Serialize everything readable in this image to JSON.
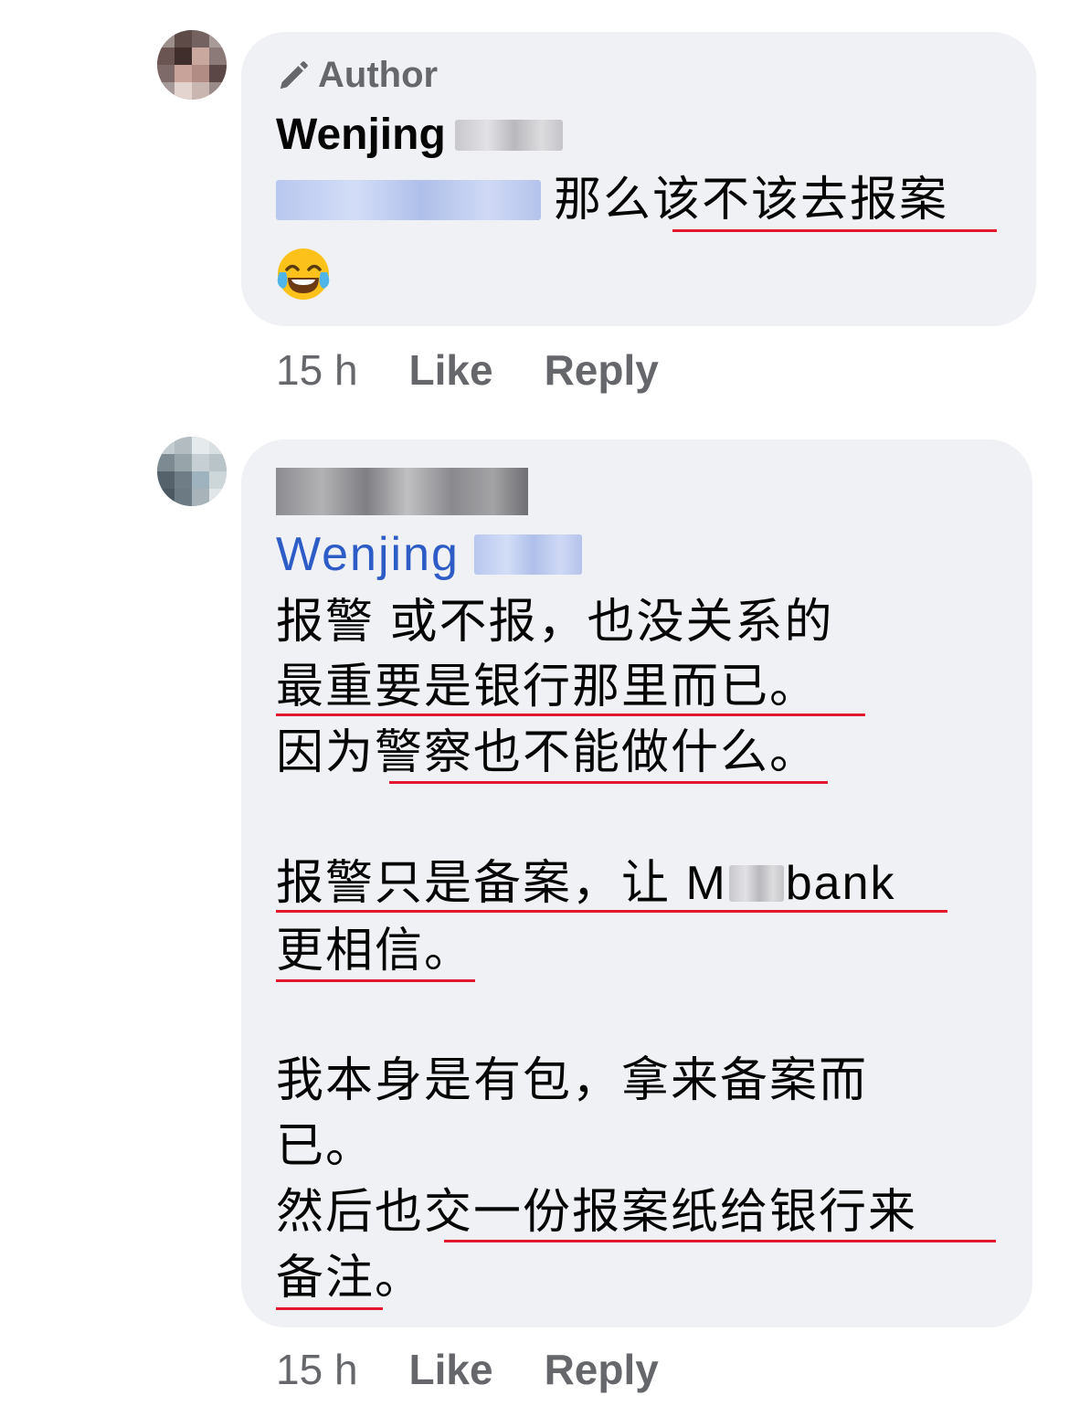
{
  "comment1": {
    "badge_label": "Author",
    "author_name": "Wenjing",
    "text": "那么该不该去报案",
    "emoji": "😂",
    "time": "15 h",
    "like_label": "Like",
    "reply_label": "Reply"
  },
  "comment2": {
    "mention": "Wenjing",
    "lines": [
      "报警 或不报，也没关系的",
      "最重要是银行那里而已。",
      "因为警察也不能做什么。",
      "报警只是备案，让 M",
      "bank",
      "更相信。",
      "我本身是有包，拿来备案而",
      "已。",
      "然后也交一份报案纸给银行来",
      "备注。"
    ],
    "time": "15 h",
    "like_label": "Like",
    "reply_label": "Reply"
  },
  "colors": {
    "bubble": "#f0f1f5",
    "mention": "#2d5cc7",
    "underline": "#e3172e",
    "meta": "#65676b"
  }
}
